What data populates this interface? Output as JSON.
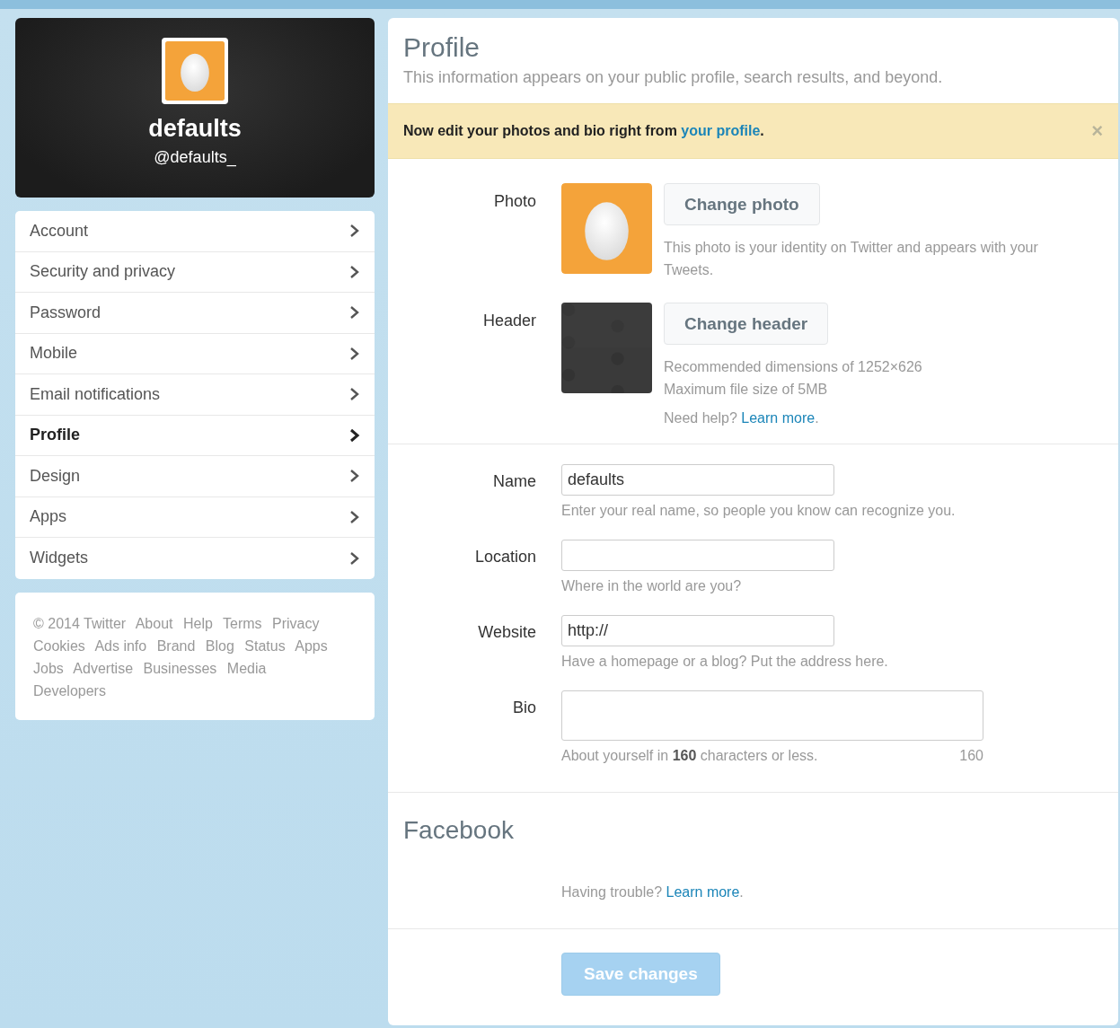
{
  "profile_card": {
    "name": "defaults",
    "handle": "@defaults_"
  },
  "nav": [
    {
      "label": "Account",
      "selected": false
    },
    {
      "label": "Security and privacy",
      "selected": false
    },
    {
      "label": "Password",
      "selected": false
    },
    {
      "label": "Mobile",
      "selected": false
    },
    {
      "label": "Email notifications",
      "selected": false
    },
    {
      "label": "Profile",
      "selected": true
    },
    {
      "label": "Design",
      "selected": false
    },
    {
      "label": "Apps",
      "selected": false
    },
    {
      "label": "Widgets",
      "selected": false
    }
  ],
  "footer_links": [
    "© 2014 Twitter",
    "About",
    "Help",
    "Terms",
    "Privacy",
    "Cookies",
    "Ads info",
    "Brand",
    "Blog",
    "Status",
    "Apps",
    "Jobs",
    "Advertise",
    "Businesses",
    "Media",
    "Developers"
  ],
  "main": {
    "title": "Profile",
    "subtitle": "This information appears on your public profile, search results, and beyond.",
    "banner": {
      "text": "Now edit your photos and bio right from",
      "link": "your profile",
      "after": ".",
      "close": "×"
    },
    "photo": {
      "label": "Photo",
      "button": "Change photo",
      "hint": "This photo is your identity on Twitter and appears with your Tweets."
    },
    "header": {
      "label": "Header",
      "button": "Change header",
      "hints": [
        "Recommended dimensions of 1252×626",
        "Maximum file size of 5MB"
      ],
      "help": {
        "text": "Need help?",
        "link": "Learn more",
        "after": "."
      }
    },
    "fields": [
      {
        "label": "Name",
        "value": "defaults",
        "hint": "Enter your real name, so people you know can recognize you.",
        "kind": "input"
      },
      {
        "label": "Location",
        "hint": "Where in the world are you?",
        "kind": "input"
      },
      {
        "label": "Website",
        "value": "http://",
        "hint": "Have a homepage or a blog? Put the address here.",
        "kind": "input"
      },
      {
        "label": "Bio",
        "hint": "About yourself in **160** characters or less.",
        "counter": "160",
        "kind": "textarea"
      }
    ],
    "facebook": {
      "title": "Facebook",
      "help": {
        "text": "Having trouble?",
        "link": "Learn more",
        "after": "."
      }
    },
    "save_button": {
      "label": "Save changes",
      "disabled": true
    }
  }
}
